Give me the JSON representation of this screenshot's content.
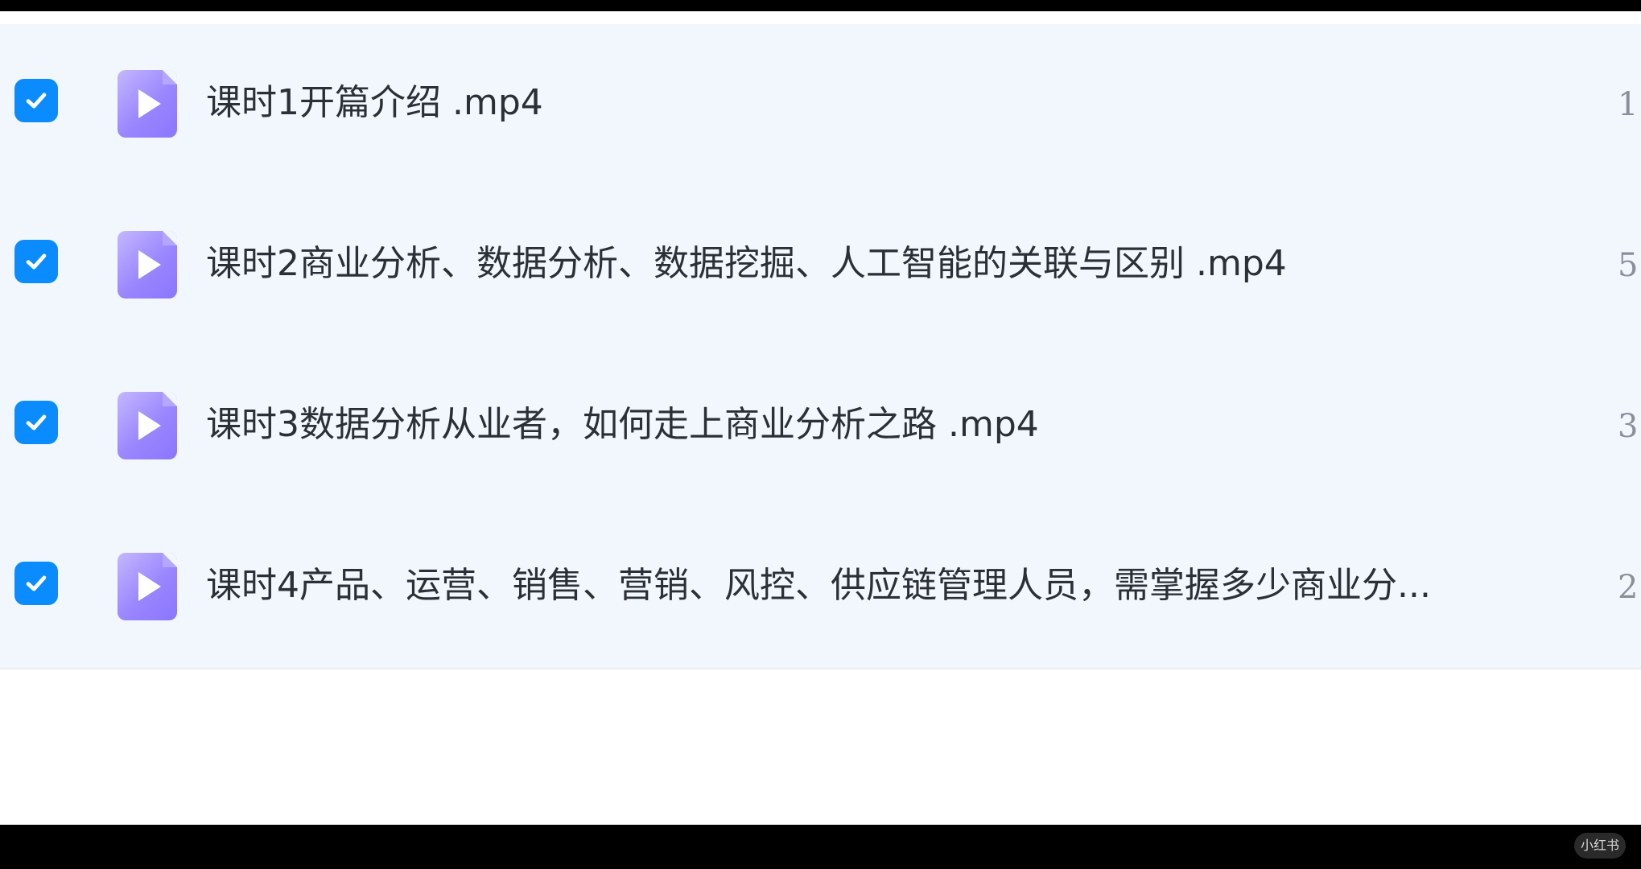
{
  "files": [
    {
      "checked": true,
      "icon": "video-file-icon",
      "name": "课时1开篇介绍 .mp4",
      "size": "1"
    },
    {
      "checked": true,
      "icon": "video-file-icon",
      "name": "课时2商业分析、数据分析、数据挖掘、人工智能的关联与区别 .mp4",
      "size": "5"
    },
    {
      "checked": true,
      "icon": "video-file-icon",
      "name": "课时3数据分析从业者，如何走上商业分析之路 .mp4",
      "size": "3"
    },
    {
      "checked": true,
      "icon": "video-file-icon",
      "name": "课时4产品、运营、销售、营销、风控、供应链管理人员，需掌握多少商业分...",
      "size": "2"
    }
  ],
  "watermark": "小红书",
  "colors": {
    "checkbox": "#0a8cff",
    "file_icon": "#9a86ff",
    "list_background": "#f1f7fc",
    "text": "#2b2f36"
  }
}
